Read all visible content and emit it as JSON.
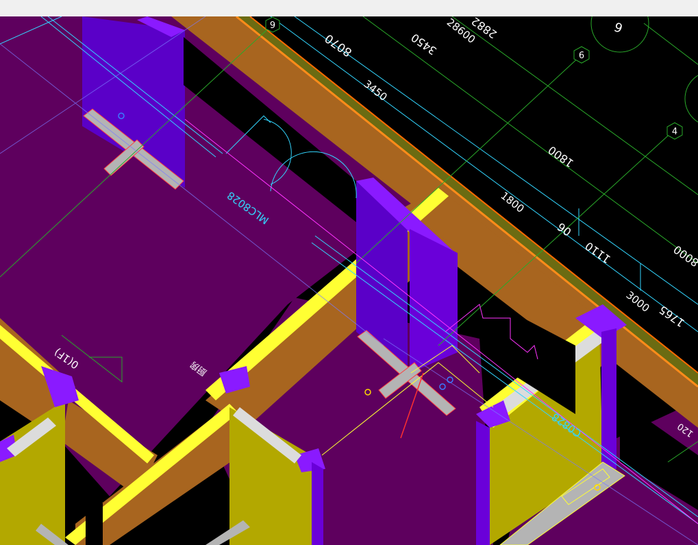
{
  "colors": {
    "background": "#000000",
    "floor": "#5e005e",
    "wall_top": "#a8651f",
    "wall_edge": "#ff8c1a",
    "column": "#6a00d9",
    "column_top": "#8a1aff",
    "partition": "#b3a800",
    "partition_top": "#ffff33",
    "beam": "#b4b4b4",
    "dimension": "#ffffff",
    "axis": "#2aa92a",
    "cyan_line": "#33d6ff"
  },
  "dimensions": {
    "d1": "8070",
    "d2": "3450",
    "d3": "28600",
    "d4": "3450",
    "d5": "1800",
    "d6": "1800",
    "d7": "06",
    "d8": "1110",
    "d9": "3000",
    "d10": "1765",
    "d11": "8000",
    "d12": "120",
    "d13": "2882"
  },
  "axis_bubbles": {
    "b9": "9",
    "b6": "6",
    "b4": "4",
    "b_top": "6"
  },
  "labels": {
    "window_label": "MLC8028",
    "door_label": "C0828",
    "level_marker": "0(1F)",
    "room_name": "厨房"
  }
}
